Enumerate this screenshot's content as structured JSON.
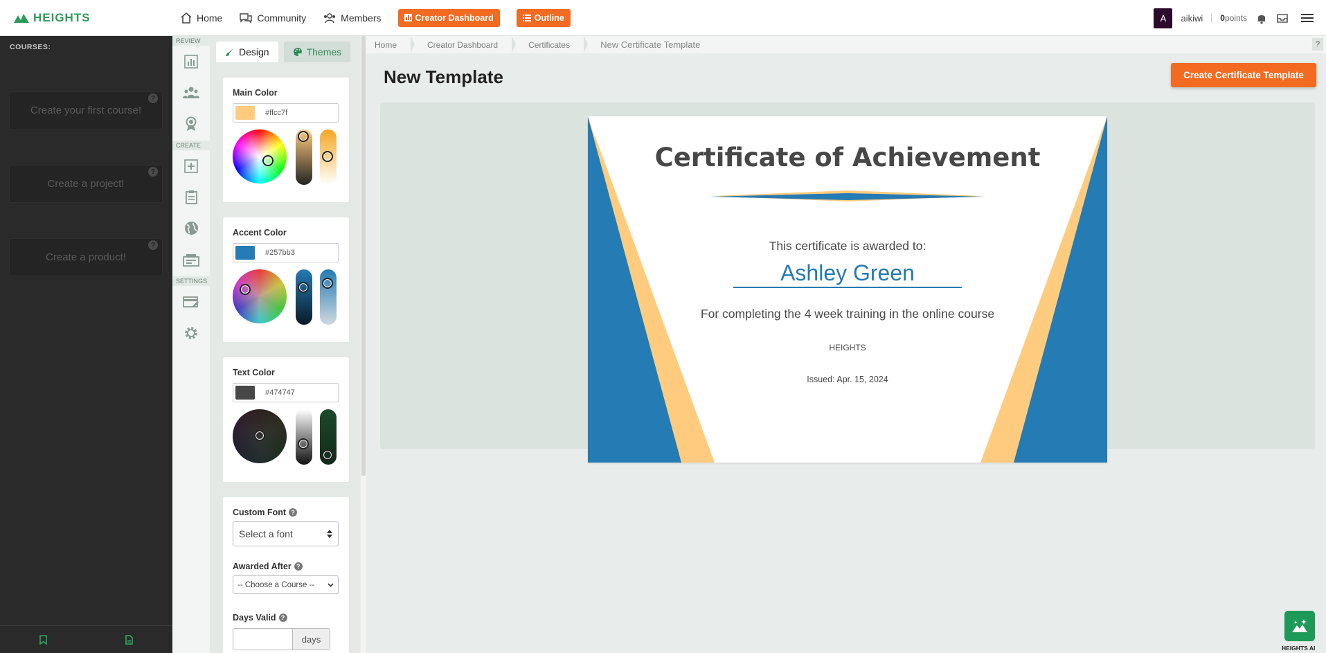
{
  "nav": {
    "logo": "HEIGHTS",
    "links": [
      {
        "label": "Home",
        "icon": "home-icon"
      },
      {
        "label": "Community",
        "icon": "chat-icon"
      },
      {
        "label": "Members",
        "icon": "members-icon"
      }
    ],
    "buttons": [
      {
        "label": "Creator Dashboard",
        "icon": "chart-icon"
      },
      {
        "label": "Outline",
        "icon": "list-icon"
      }
    ],
    "avatar_letter": "A",
    "username": "aikiwi",
    "points_value": "0",
    "points_label": "points"
  },
  "sidebar": {
    "courses_label": "COURSES:",
    "cards": [
      "Create your first course!",
      "Create a project!",
      "Create a product!"
    ],
    "help_mark": "?"
  },
  "rail": {
    "review_label": "REVIEW",
    "create_label": "CREATE",
    "settings_label": "SETTINGS"
  },
  "panel": {
    "tabs": [
      {
        "label": "Design",
        "active": true
      },
      {
        "label": "Themes",
        "active": false
      }
    ],
    "colors": [
      {
        "title": "Main Color",
        "hex": "#ffcc7f"
      },
      {
        "title": "Accent Color",
        "hex": "#257bb3"
      },
      {
        "title": "Text Color",
        "hex": "#474747"
      }
    ],
    "custom_font_label": "Custom Font",
    "font_placeholder": "Select a font",
    "awarded_after_label": "Awarded After",
    "course_placeholder": "-- Choose a Course --",
    "days_valid_label": "Days Valid",
    "days_addon": "days"
  },
  "breadcrumb": [
    "Home",
    "Creator Dashboard",
    "Certificates",
    "New Certificate Template"
  ],
  "help_tab": "?",
  "page_title": "New Template",
  "create_button": "Create Certificate Template",
  "certificate": {
    "title": "Certificate of Achievement",
    "awarded_to": "This certificate is awarded to:",
    "recipient": "Ashley Green",
    "description": "For completing the 4 week training in the online course",
    "organization": "HEIGHTS",
    "issued": "Issued: Apr. 15, 2024"
  },
  "ai_label": "HEIGHTS AI"
}
